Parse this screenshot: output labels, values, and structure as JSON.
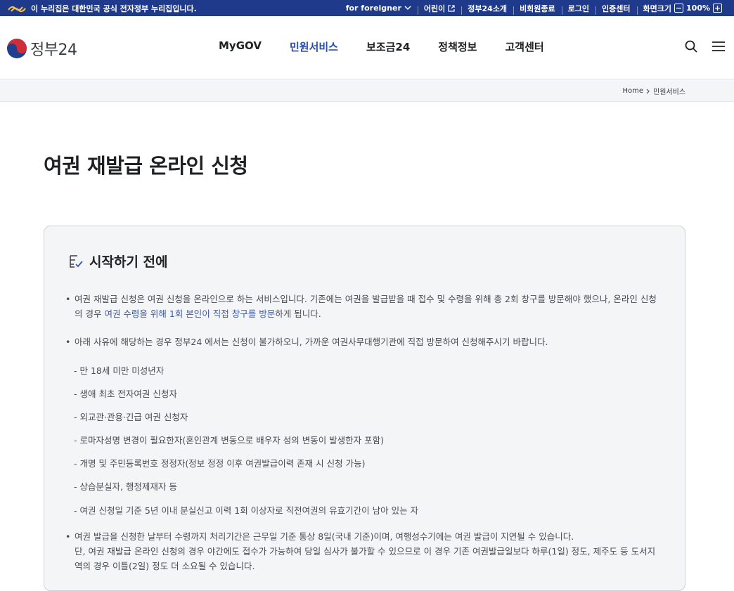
{
  "topbar": {
    "gov_notice": "이 누리집은 대한민국 공식 전자정부 누리집입니다.",
    "foreigner": "for foreigner",
    "kids": "어린이",
    "about": "정부24소개",
    "guest_exit": "비회원종료",
    "login": "로그인",
    "cert": "인증센터",
    "screen_size": "화면크기",
    "zoom_out": "−",
    "zoom_value": "100%",
    "zoom_in": "+"
  },
  "header": {
    "logo_text": "정부24",
    "nav": [
      "MyGOV",
      "민원서비스",
      "보조금24",
      "정책정보",
      "고객센터"
    ]
  },
  "breadcrumb": {
    "home": "Home",
    "current": "민원서비스"
  },
  "page_title": "여권 재발급 온라인 신청",
  "before_start": {
    "title": "시작하기 전에",
    "p1_a": "여권 재발급 신청은 여권 신청을 온라인으로 하는 서비스입니다. 기존에는 여권을 발급받을 때 접수 및 수령을 위해 총 2회 창구를 방문해야 했으나, 온라인 신청의 경우 ",
    "p1_blue": "여권 수령을 위해 1회 본인이 직접 창구를 방문",
    "p1_b": "하게 됩니다.",
    "p2": "아래 사유에 해당하는 경우 정부24 에서는 신청이 불가하오니, 가까운 여권사무대행기관에 직접 방문하여 신청해주시기 바랍니다.",
    "items": [
      "- 만 18세 미만 미성년자",
      "- 생애 최초 전자여권 신청자",
      "- 외교관·관용·긴급 여권 신청자",
      "- 로마자성명 변경이 필요한자(혼인관계 변동으로 배우자 성의 변동이 발생한자 포함)",
      "- 개명 및 주민등록번호 정정자(정보 정정 이후 여권발급이력 존재 시 신청 가능)",
      "- 상습분실자, 행정제재자 등",
      "- 여권 신청일 기준 5년 이내 분실신고 이력 1회 이상자로 직전여권의 유효기간이 남아 있는 자"
    ],
    "p3_line1": "여권 발급을 신청한 날부터 수령까지 처리기간은 근무일 기준 통상 8일(국내 기준)이며, 여행성수기에는 여권 발급이 지연될 수 있습니다.",
    "p3_line2": "단, 여권 재발급 온라인 신청의 경우 야간에도 접수가 가능하여 당일 심사가 불가할 수 있으므로 이 경우 기존 여권발급일보다 하루(1일) 정도, 제주도 등 도서지역의 경우 이틀(2일) 정도 더 소요될 수 있습니다."
  },
  "colors": {
    "topbar": "#1f3a8a",
    "active_nav": "#2a4ea8",
    "link_blue": "#3b5aa8"
  }
}
